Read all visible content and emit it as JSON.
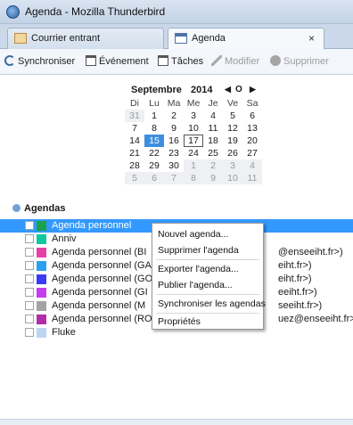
{
  "window": {
    "title": "Agenda - Mozilla Thunderbird"
  },
  "tabs": [
    {
      "label": "Courrier entrant",
      "icon": "mail-icon"
    },
    {
      "label": "Agenda",
      "icon": "calendar-icon",
      "close": "×"
    }
  ],
  "toolbar": {
    "sync": "Synchroniser",
    "event": "Événement",
    "tasks": "Tâches",
    "modify": "Modifier",
    "delete": "Supprimer"
  },
  "minimonth": {
    "month": "Septembre",
    "year": "2014",
    "nav_prev": "◀",
    "nav_today": "O",
    "nav_next": "▶",
    "weekdays": [
      "Di",
      "Lu",
      "Ma",
      "Me",
      "Je",
      "Ve",
      "Sa"
    ],
    "weeks": [
      [
        "31",
        "1",
        "2",
        "3",
        "4",
        "5",
        "6"
      ],
      [
        "7",
        "8",
        "9",
        "10",
        "11",
        "12",
        "13"
      ],
      [
        "14",
        "15",
        "16",
        "17",
        "18",
        "19",
        "20"
      ],
      [
        "21",
        "22",
        "23",
        "24",
        "25",
        "26",
        "27"
      ],
      [
        "28",
        "29",
        "30",
        "1",
        "2",
        "3",
        "4"
      ],
      [
        "5",
        "6",
        "7",
        "8",
        "9",
        "10",
        "11"
      ]
    ],
    "selected_day": "15",
    "today_day": "17"
  },
  "agendas": {
    "header": "Agendas",
    "items": [
      {
        "name": "Agenda personnel",
        "email": "",
        "color": "#1aa34a",
        "selected": true
      },
      {
        "name": "Anniv",
        "email": "",
        "color": "#0ec9a0"
      },
      {
        "name": "Agenda personnel (BI",
        "email": "@enseeiht.fr>)",
        "color": "#e83ea8"
      },
      {
        "name": "Agenda personnel (GA",
        "email": "eiht.fr>)",
        "color": "#2b9ff0"
      },
      {
        "name": "Agenda personnel (GO",
        "email": "eiht.fr>)",
        "color": "#3b3bf5"
      },
      {
        "name": "Agenda personnel (GI",
        "email": "eeiht.fr>)",
        "color": "#c43df0"
      },
      {
        "name": "Agenda personnel (M",
        "email": "seeiht.fr>)",
        "color": "#a3a3a3"
      },
      {
        "name": "Agenda personnel (RO",
        "email": "uez@enseeiht.fr>)",
        "color": "#b12ea8"
      },
      {
        "name": "Fluke",
        "email": "",
        "color": "#bcd6f2"
      }
    ]
  },
  "context_menu": {
    "new": "Nouvel agenda...",
    "delete": "Supprimer l'agenda",
    "export": "Exporter l'agenda...",
    "publish": "Publier l'agenda...",
    "sync": "Synchroniser les agendas",
    "props": "Propriétés"
  }
}
